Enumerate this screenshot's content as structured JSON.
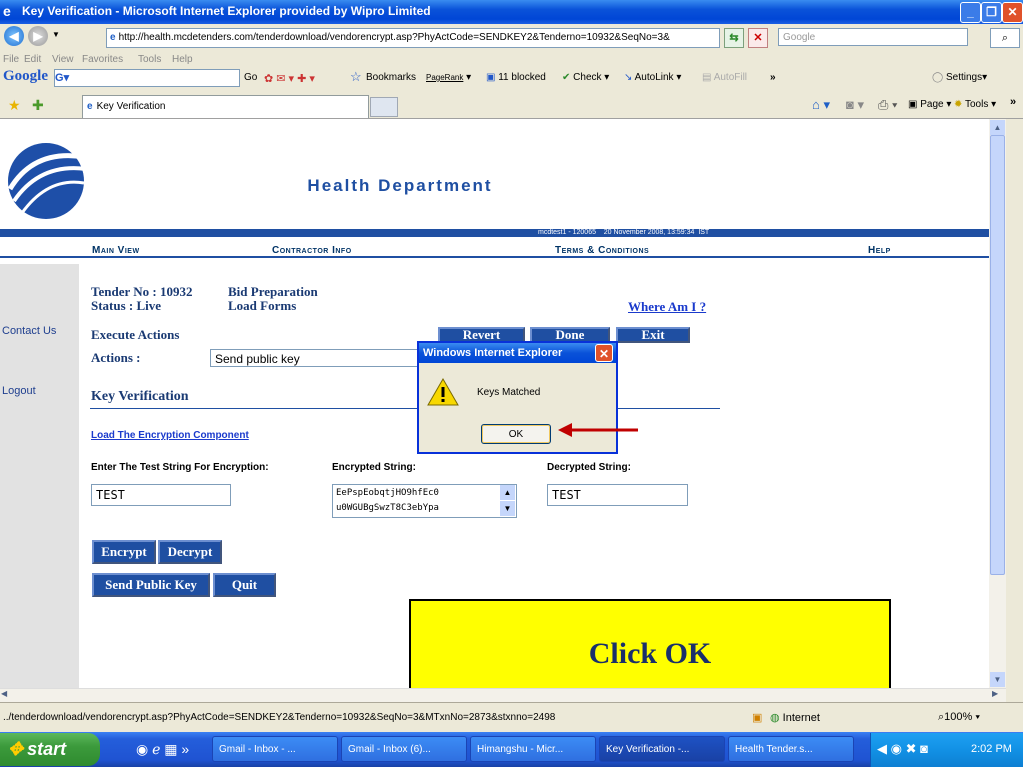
{
  "window": {
    "title": "Key Verification - Microsoft Internet Explorer provided by Wipro Limited",
    "address": "http://health.mcdetenders.com/tenderdownload/vendorencrypt.asp?PhyActCode=SENDKEY2&Tenderno=10932&SeqNo=3&",
    "search_placeholder": "Google"
  },
  "menu": [
    "File",
    "Edit",
    "View",
    "Favorites",
    "Tools",
    "Help"
  ],
  "google_toolbar": {
    "logo": "Google",
    "field": "G",
    "go": "Go",
    "bookmarks": "Bookmarks",
    "pagerank": "PageRank",
    "blocked": "11 blocked",
    "check": "Check",
    "autolink": "AutoLink",
    "autofill": "AutoFill",
    "settings": "Settings"
  },
  "tab": {
    "label": "Key Verification"
  },
  "cmd_bar": {
    "page": "Page",
    "tools": "Tools"
  },
  "page": {
    "header_title": "Health Department",
    "user_info": "mcdtest1 - 120065    20 November 2008, 13:59:34  IST",
    "nav": [
      "Main View",
      "Contractor Info",
      "Terms & Conditions",
      "Help"
    ],
    "tender_no": "Tender No : 10932",
    "status": "Status : Live",
    "bid_prep": "Bid Preparation",
    "load_forms": "Load Forms",
    "where_am_i": "Where Am I ?",
    "contact_us": "Contact Us",
    "logout": "Logout",
    "execute_actions": "Execute Actions",
    "actions_label": "Actions :",
    "actions_value": "Send public key",
    "revert": "Revert",
    "done": "Done",
    "exit": "Exit",
    "section_title": "Key Verification",
    "load_component": "Load The Encryption Component",
    "test_string_label": "Enter The Test String For Encryption:",
    "encrypted_label": "Encrypted String:",
    "decrypted_label": "Decrypted String:",
    "test_string_value": "TEST",
    "encrypted_line1": "EePspEobqtjHO9hfEc0",
    "encrypted_line2": "u0WGUBgSwzT8C3ebYpa",
    "decrypted_value": "TEST",
    "encrypt": "Encrypt",
    "decrypt": "Decrypt",
    "send_public_key": "Send Public Key",
    "quit": "Quit"
  },
  "dialog": {
    "title": "Windows Internet Explorer",
    "message": "Keys Matched",
    "ok": "OK"
  },
  "callout": {
    "text": "Click OK"
  },
  "status_bar": {
    "url": "../tenderdownload/vendorencrypt.asp?PhyActCode=SENDKEY2&Tenderno=10932&SeqNo=3&MTxnNo=2873&stxnno=2498",
    "zone": "Internet",
    "zoom": "100%"
  },
  "taskbar": {
    "start": "start",
    "tasks": [
      "Gmail - Inbox - ...",
      "Gmail - Inbox (6)...",
      "Himangshu - Micr...",
      "Key Verification -...",
      "Health Tender.s..."
    ],
    "clock": "2:02 PM"
  },
  "colors": {
    "accent": "#1f4fa2",
    "callout": "#ffff00",
    "arrow": "#c00000"
  }
}
